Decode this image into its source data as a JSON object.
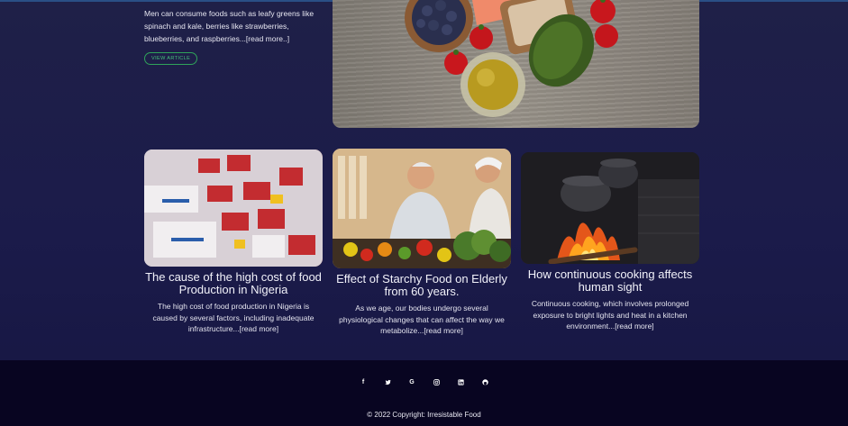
{
  "featured": {
    "excerpt": "Men can consume foods such as leafy greens like spinach and kale, berries like strawberries, blueberries, and raspberries...",
    "read_more": "[read more..]",
    "button_label": "VIEW ARTICLE"
  },
  "cards": [
    {
      "title": "The cause of the high cost of food Production in Nigeria",
      "excerpt": "The high cost of food production in Nigeria is caused by several factors, including inadequate infrastructure...",
      "read_more": "[read more]"
    },
    {
      "title": "Effect of Starchy Food on Elderly from 60 years.",
      "excerpt": "As we age, our bodies undergo several physiological changes that can affect the way we metabolize...",
      "read_more": "[read more]"
    },
    {
      "title": "How continuous cooking affects human sight",
      "excerpt": "Continuous cooking, which involves prolonged exposure to bright lights and heat in a kitchen environment...",
      "read_more": "[read more]"
    }
  ],
  "footer": {
    "socials": [
      {
        "icon": "facebook-icon",
        "glyph": "f"
      },
      {
        "icon": "twitter-icon",
        "glyph": ""
      },
      {
        "icon": "google-icon",
        "glyph": "G"
      },
      {
        "icon": "instagram-icon",
        "glyph": ""
      },
      {
        "icon": "linkedin-icon",
        "glyph": ""
      },
      {
        "icon": "github-icon",
        "glyph": ""
      }
    ],
    "copyright": "© 2022 Copyright: Irresistable Food"
  },
  "colors": {
    "background": "#1d1e4a",
    "footer": "#080521",
    "accent_green": "#46c27a",
    "top_line": "#2a4f86"
  }
}
